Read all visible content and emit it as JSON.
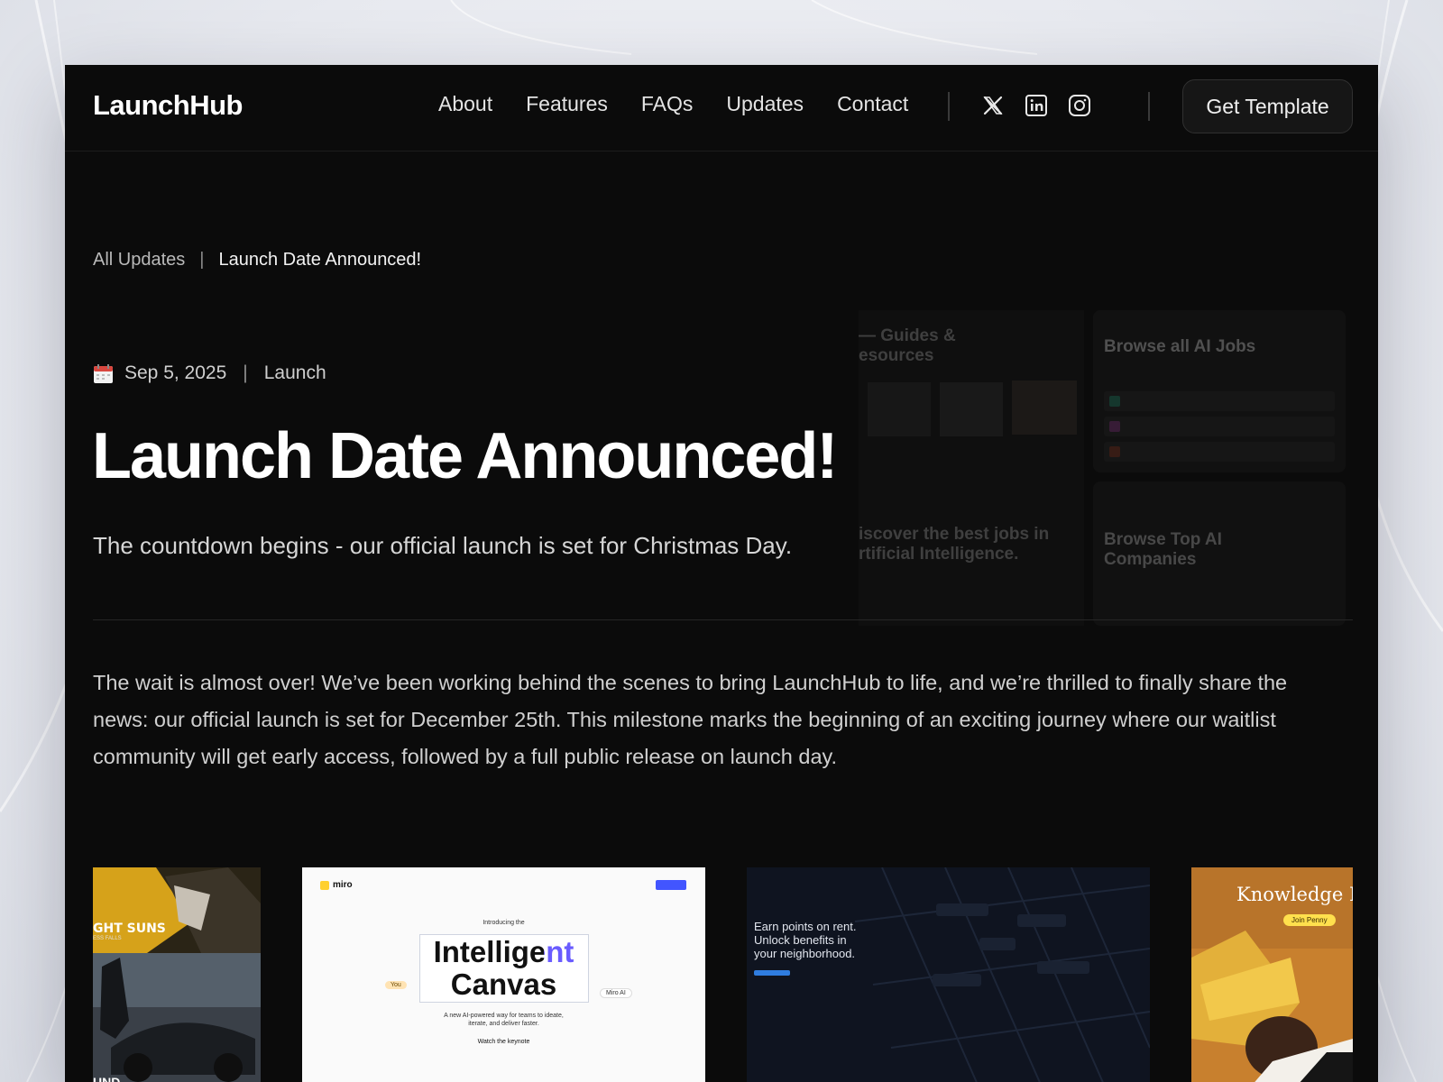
{
  "nav": {
    "logo": "LaunchHub",
    "links": [
      "About",
      "Features",
      "FAQs",
      "Updates",
      "Contact"
    ],
    "social": [
      "x-icon",
      "linkedin-icon",
      "instagram-icon"
    ],
    "cta": "Get Template"
  },
  "breadcrumb": {
    "parent": "All Updates",
    "separator": "|",
    "current": "Launch Date Announced!"
  },
  "post": {
    "date": "Sep 5, 2025",
    "separator": "|",
    "category": "Launch",
    "title": "Launch Date Announced!",
    "subtitle": "The countdown begins - our official launch is set for Christmas Day.",
    "body": "The wait is almost over! We’ve been working behind the scenes to bring LaunchHub to life, and we’re thrilled to finally share the news: our official launch is set for December 25th. This milestone marks the beginning of an exciting journey where our waitlist community will get early access, followed by a full public release on launch day."
  },
  "showcase": {
    "left_heading_1": "— Guides &",
    "left_heading_2": "esources",
    "left_heading_3": "iscover the best jobs in",
    "left_heading_4": "rtificial Intelligence.",
    "right_heading_1": "Browse all AI Jobs",
    "right_heading_2": "Browse Top AI",
    "right_heading_3": "Companies"
  },
  "gallery": {
    "tile1_text_1": "GHT SUNS",
    "tile1_text_2": "ESS FALLS",
    "tile1_text_3": "UND",
    "tile2_brand": "miro",
    "tile2_intro": "Introducing the",
    "tile2_title_1": "Intelligent",
    "tile2_title_2": "Canvas",
    "tile2_desc": "A new AI-powered way for teams to ideate, iterate, and deliver faster.",
    "tile2_cta": "Watch the keynote",
    "tile2_you": "You",
    "tile2_ai": "Miro AI",
    "tile3_line1": "Earn points on rent.",
    "tile3_line2": "Unlock benefits in",
    "tile3_line3": "your neighborhood.",
    "tile4_title": "Knowledge Dr",
    "tile4_cta": "Join Penny"
  },
  "colors": {
    "page_bg": "#0b0b0b",
    "text_primary": "#ffffff",
    "text_muted": "#cfcfcf",
    "miro_yellow": "#ffd02f",
    "accent_purple": "#6a5cff"
  }
}
